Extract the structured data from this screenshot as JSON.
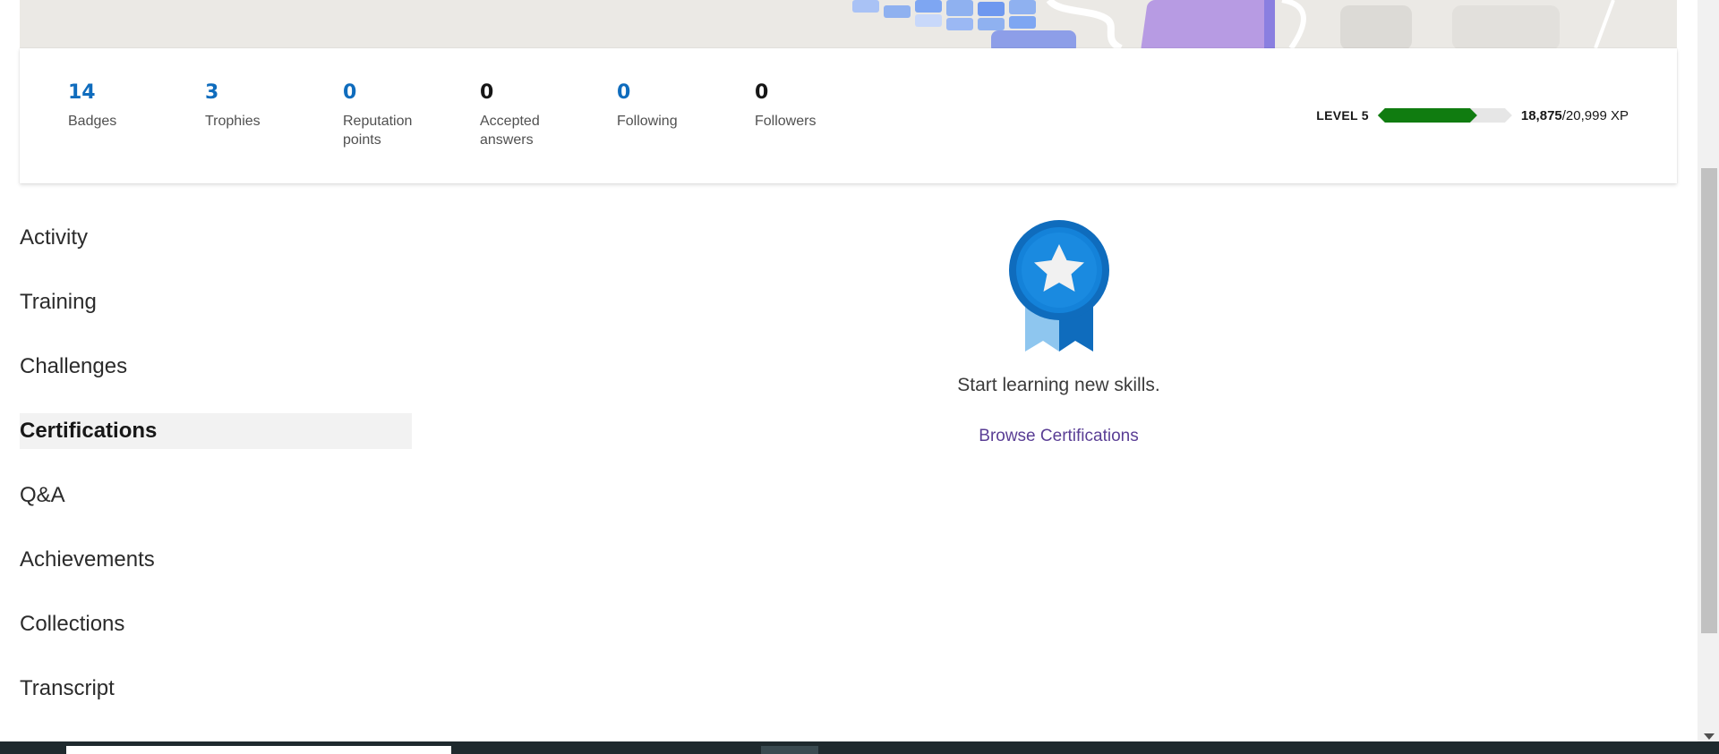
{
  "stats": [
    {
      "value": "14",
      "label": "Badges",
      "color": "blue"
    },
    {
      "value": "3",
      "label": "Trophies",
      "color": "blue"
    },
    {
      "value": "0",
      "label": "Reputation points",
      "color": "blue"
    },
    {
      "value": "0",
      "label": "Accepted answers",
      "color": "dark"
    },
    {
      "value": "0",
      "label": "Following",
      "color": "blue"
    },
    {
      "value": "0",
      "label": "Followers",
      "color": "dark"
    }
  ],
  "level": {
    "label": "LEVEL 5",
    "xp_current": "18,875",
    "xp_total": "/20,999 XP",
    "progress_fraction": 0.74,
    "fill_color": "#107c10"
  },
  "nav": {
    "items": [
      {
        "label": "Activity"
      },
      {
        "label": "Training"
      },
      {
        "label": "Challenges"
      },
      {
        "label": "Certifications",
        "active": true
      },
      {
        "label": "Q&A"
      },
      {
        "label": "Achievements"
      },
      {
        "label": "Collections"
      },
      {
        "label": "Transcript"
      }
    ]
  },
  "empty_state": {
    "icon": "certification-ribbon-icon",
    "message": "Start learning new skills.",
    "link_label": "Browse Certifications"
  },
  "colors": {
    "accent_blue": "#0f6cbd",
    "link_purple": "#5a3e95"
  }
}
